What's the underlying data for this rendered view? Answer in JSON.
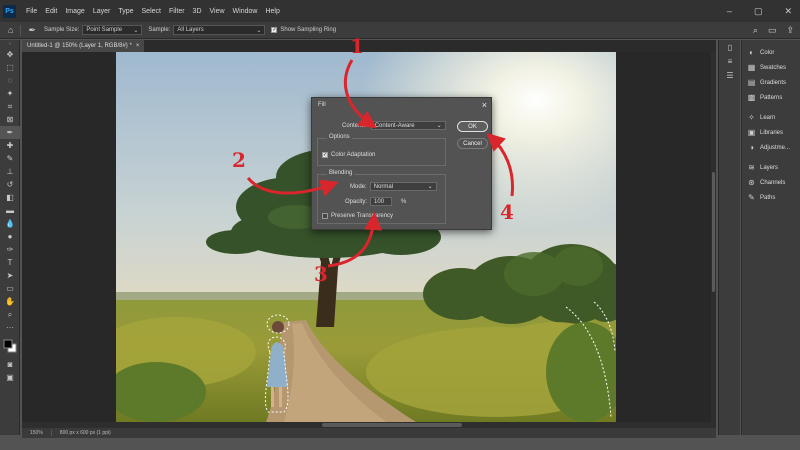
{
  "menubar": {
    "logo": "Ps",
    "items": [
      "File",
      "Edit",
      "Image",
      "Layer",
      "Type",
      "Select",
      "Filter",
      "3D",
      "View",
      "Window",
      "Help"
    ]
  },
  "options": {
    "sample_size_label": "Sample Size:",
    "sample_size_value": "Point Sample",
    "sample_label": "Sample:",
    "sample_value": "All Layers",
    "sampling_ring_label": "Show Sampling Ring"
  },
  "document": {
    "tab_title": "Untitled-1 @ 150% (Layer 1, RGB/8#) *",
    "tab_close": "×"
  },
  "status": {
    "zoom": "150%",
    "dimensions": "800 px x 600 px (1 ppi)"
  },
  "panels": {
    "items": [
      {
        "label": "Color",
        "icon": "color-icon",
        "glyph": "◐"
      },
      {
        "label": "Swatches",
        "icon": "swatches-icon",
        "glyph": "▦"
      },
      {
        "label": "Gradients",
        "icon": "gradients-icon",
        "glyph": "▤"
      },
      {
        "label": "Patterns",
        "icon": "patterns-icon",
        "glyph": "▩"
      },
      {
        "label": "Learn",
        "icon": "learn-icon",
        "glyph": "✧"
      },
      {
        "label": "Libraries",
        "icon": "libraries-icon",
        "glyph": "▣"
      },
      {
        "label": "Adjustme...",
        "icon": "adjustments-icon",
        "glyph": "◑"
      },
      {
        "label": "Layers",
        "icon": "layers-icon",
        "glyph": "≋"
      },
      {
        "label": "Channels",
        "icon": "channels-icon",
        "glyph": "⊛"
      },
      {
        "label": "Paths",
        "icon": "paths-icon",
        "glyph": "✎"
      }
    ]
  },
  "fill_dialog": {
    "title": "Fill",
    "close": "×",
    "contents_label": "Contents:",
    "contents_value": "Content-Aware",
    "options_label": "Options",
    "color_adaptation_label": "Color Adaptation",
    "color_adaptation_checked": true,
    "blending_label": "Blending",
    "mode_label": "Mode:",
    "mode_value": "Normal",
    "opacity_label": "Opacity:",
    "opacity_value": "100",
    "opacity_unit": "%",
    "preserve_transparency_label": "Preserve Transparency",
    "preserve_transparency_checked": false,
    "ok_label": "OK",
    "cancel_label": "Cancel"
  },
  "annotations": {
    "numbers": [
      "1",
      "2",
      "3",
      "4"
    ],
    "color": "#d9262c"
  },
  "colors": {
    "app_bg": "#535353",
    "menubar": "#323232",
    "panel": "#3c3c3c",
    "canvas_bg": "#282828",
    "accent": "#31a8ff"
  }
}
